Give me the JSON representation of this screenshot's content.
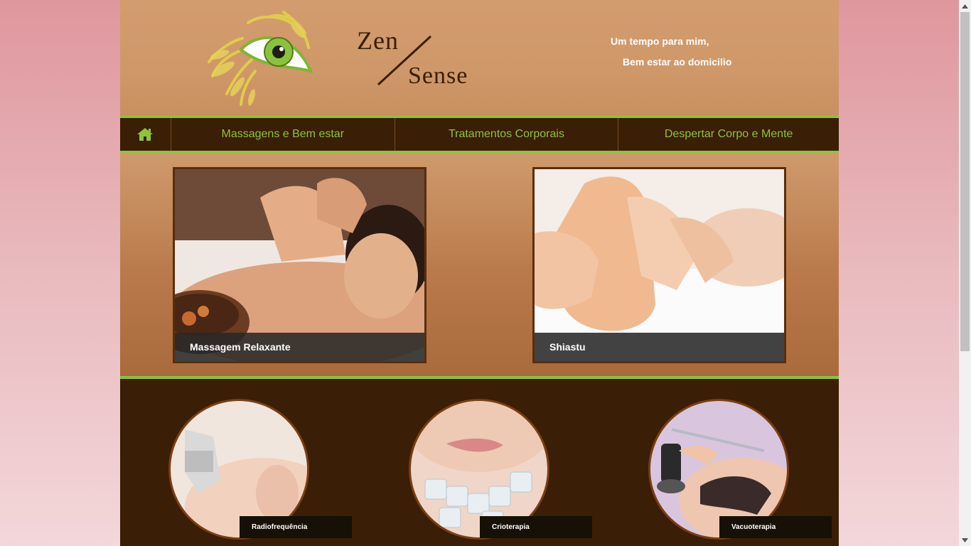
{
  "header": {
    "brand_top": "Zen",
    "brand_bottom": "Sense",
    "tagline_1": "Um tempo para mim,",
    "tagline_2": "Bem estar ao domicilio"
  },
  "nav": {
    "home_icon": "home-icon",
    "items": [
      {
        "label": "Massagens e Bem estar"
      },
      {
        "label": "Tratamentos Corporais"
      },
      {
        "label": "Despertar Corpo e Mente"
      }
    ]
  },
  "featured": [
    {
      "caption": "Massagem Relaxante"
    },
    {
      "caption": "Shiastu"
    }
  ],
  "services": [
    {
      "label": "Radiofrequência"
    },
    {
      "label": "Crioterapia"
    },
    {
      "label": "Vacuoterapia"
    }
  ],
  "colors": {
    "accent_green": "#8fc33d",
    "dark_brown": "#3a1e05",
    "header_tan": "#d39c6e"
  }
}
